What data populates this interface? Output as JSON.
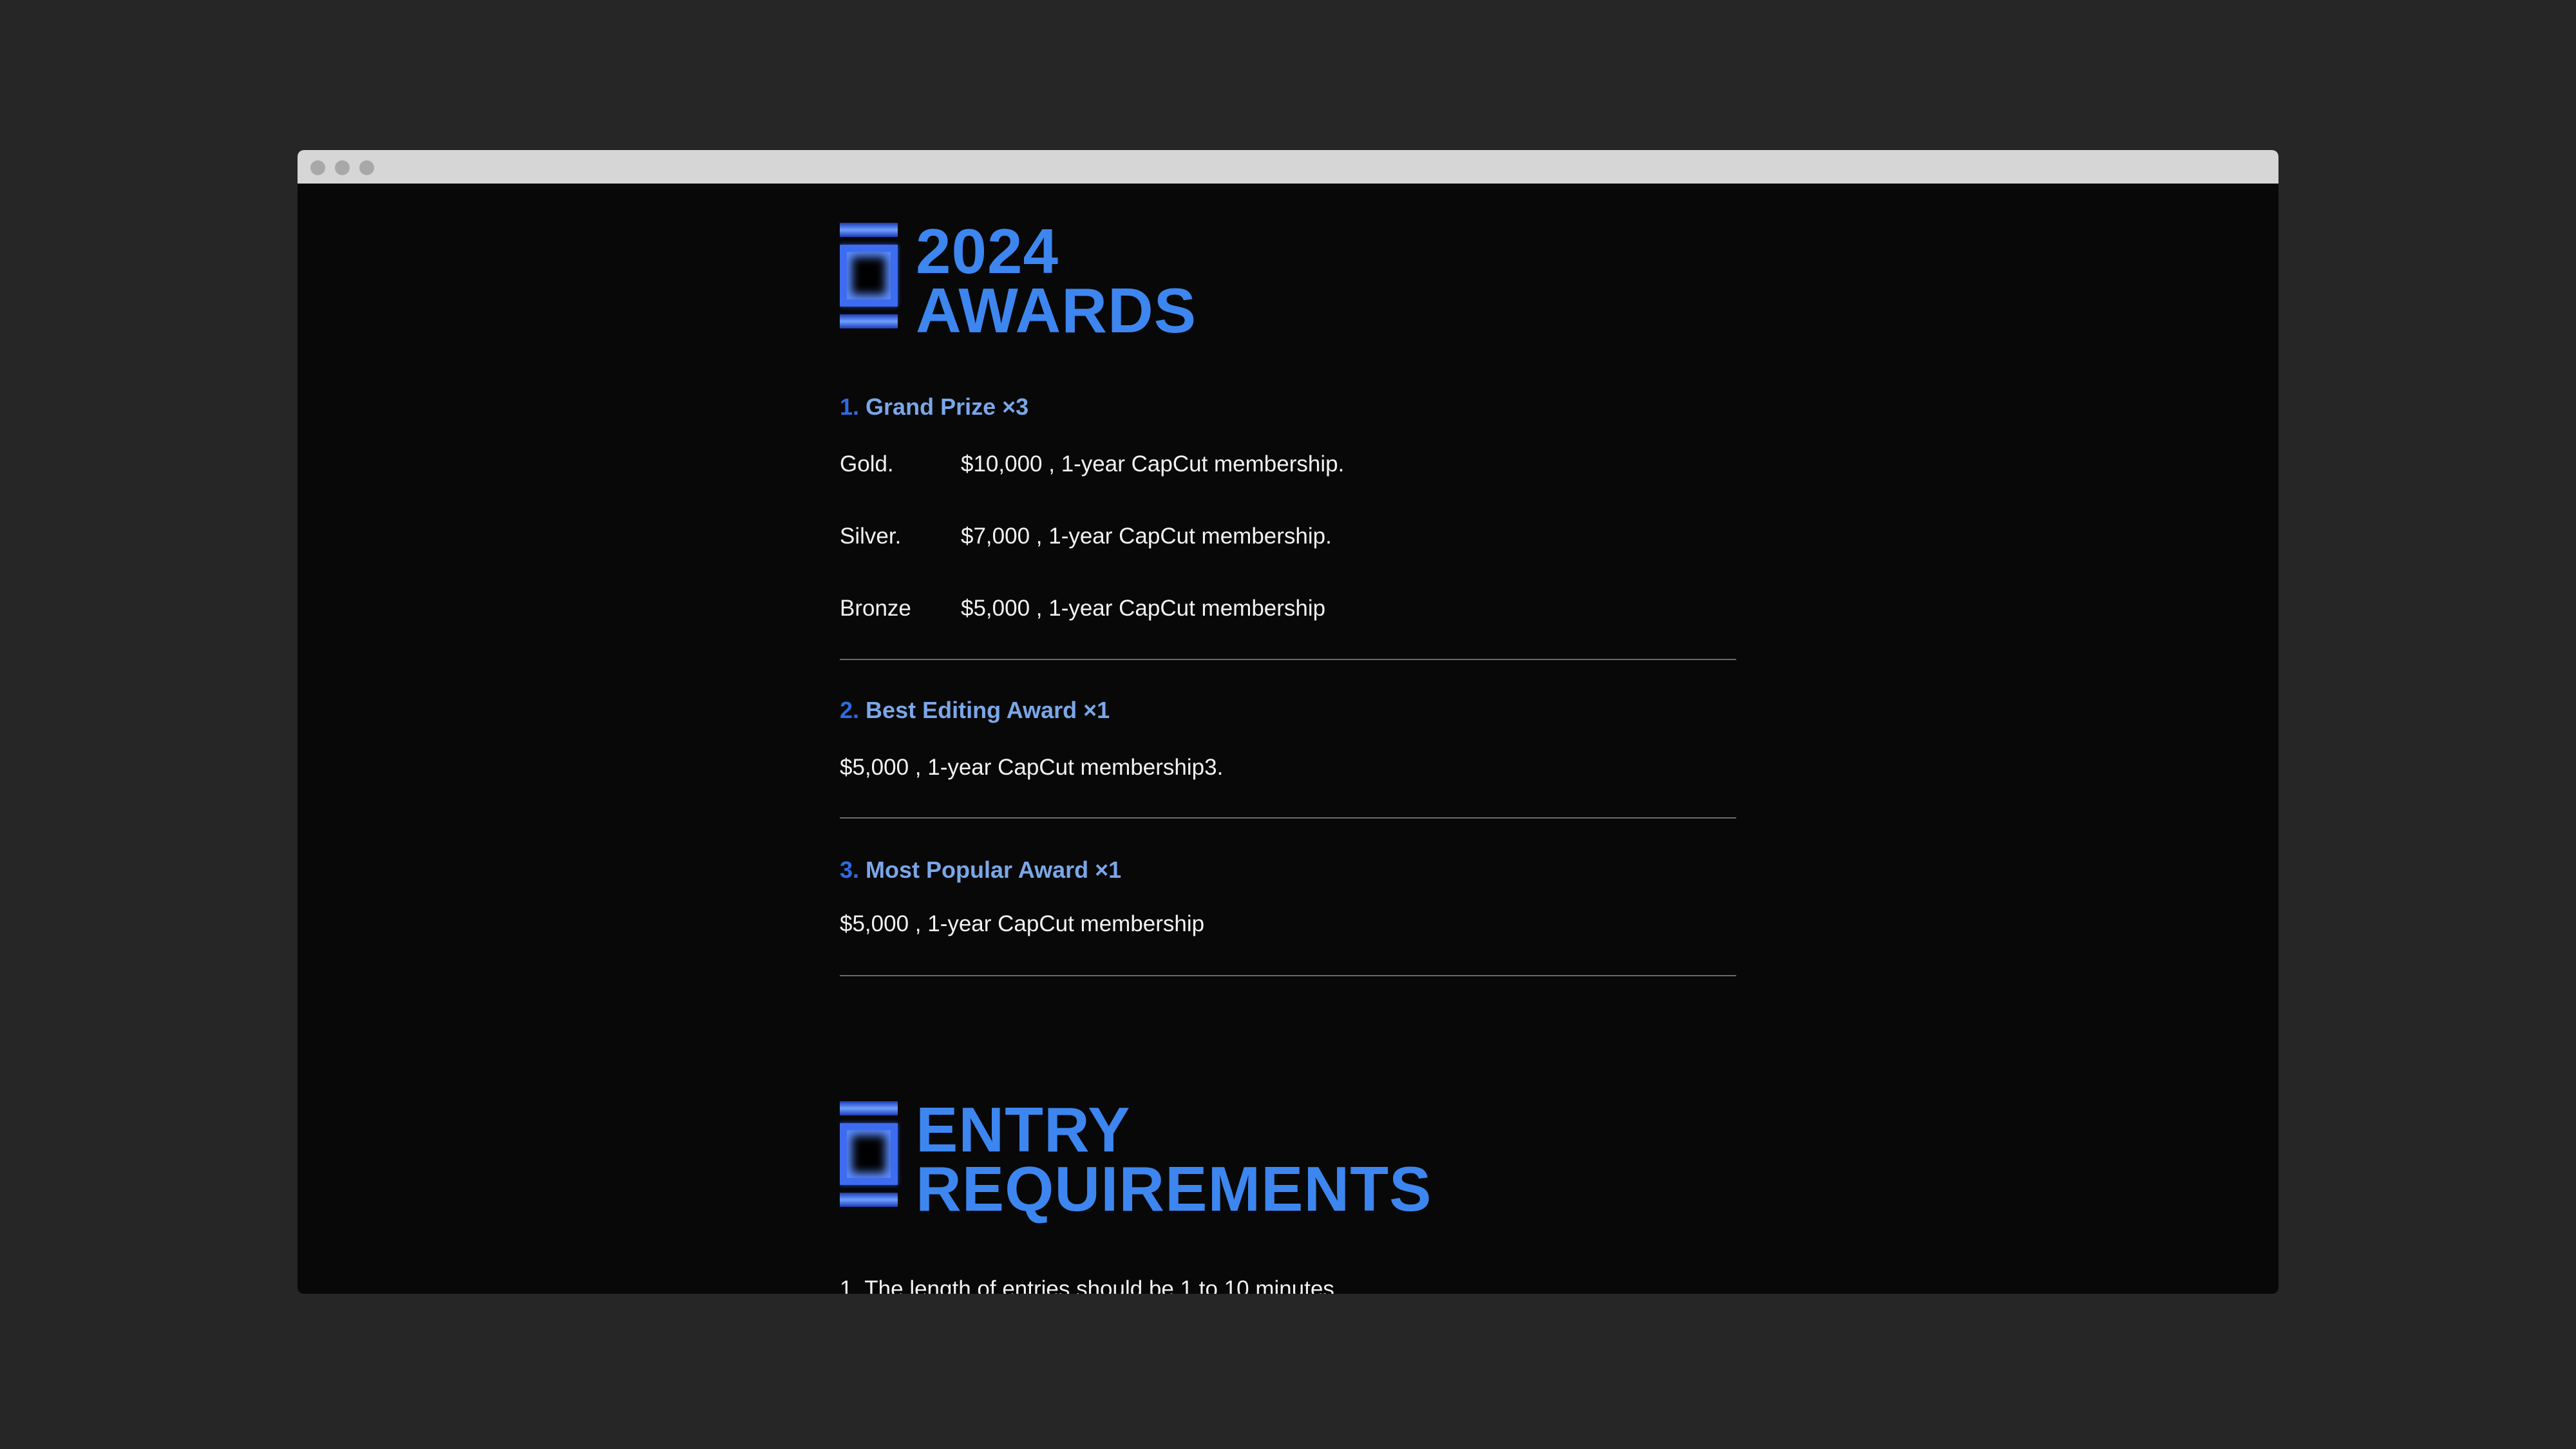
{
  "awards": {
    "title_line1": "2024",
    "title_line2": "AWARDS",
    "grand_prize": {
      "number": "1.",
      "title": "Grand Prize ×3",
      "rows": [
        {
          "tier": "Gold.",
          "prize": "$10,000 , 1-year CapCut membership."
        },
        {
          "tier": "Silver.",
          "prize": "$7,000 , 1-year CapCut membership."
        },
        {
          "tier": "Bronze",
          "prize": "$5,000 , 1-year CapCut membership"
        }
      ]
    },
    "best_editing": {
      "number": "2.",
      "title": "Best Editing Award ×1",
      "prize": "$5,000 , 1-year CapCut membership3."
    },
    "most_popular": {
      "number": "3.",
      "title": "Most Popular Award ×1",
      "prize": "$5,000 , 1-year CapCut membership"
    }
  },
  "entry": {
    "title_line1": "ENTRY",
    "title_line2": "REQUIREMENTS",
    "items": [
      "1. The length of entries should be 1 to 10 minutes"
    ]
  },
  "colors": {
    "accent": "#3d86f0",
    "award_heading": "#7aa7e8",
    "page_bg": "#080808",
    "outer_bg": "#262626"
  }
}
